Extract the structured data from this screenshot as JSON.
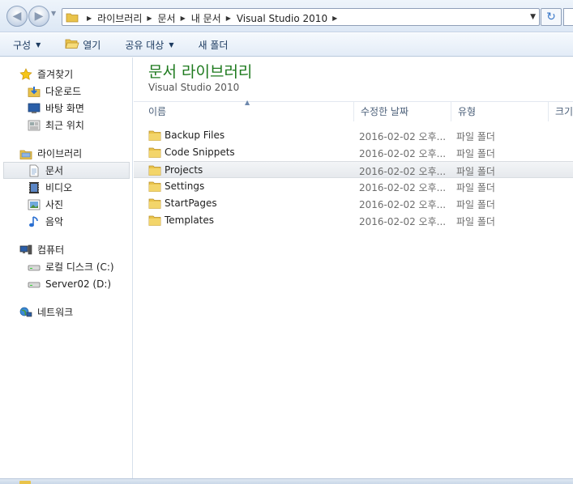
{
  "address": {
    "crumbs": [
      "라이브러리",
      "문서",
      "내 문서",
      "Visual Studio 2010"
    ]
  },
  "toolbar": {
    "organize": "구성",
    "open": "열기",
    "share": "공유 대상",
    "new_folder": "새 폴더"
  },
  "nav": {
    "favorites": {
      "label": "즐겨찾기",
      "items": [
        "다운로드",
        "바탕 화면",
        "최근 위치"
      ]
    },
    "libraries": {
      "label": "라이브러리",
      "items": [
        "문서",
        "비디오",
        "사진",
        "음악"
      ]
    },
    "computer": {
      "label": "컴퓨터",
      "items": [
        "로컬 디스크 (C:)",
        "Server02 (D:)"
      ]
    },
    "network": {
      "label": "네트워크"
    }
  },
  "library": {
    "title": "문서 라이브러리",
    "subtitle": "Visual Studio 2010"
  },
  "columns": {
    "name": "이름",
    "date": "수정한 날짜",
    "type": "유형",
    "size": "크기"
  },
  "files": [
    {
      "name": "Backup Files",
      "date": "2016-02-02 오후...",
      "type": "파일 폴더"
    },
    {
      "name": "Code Snippets",
      "date": "2016-02-02 오후...",
      "type": "파일 폴더"
    },
    {
      "name": "Projects",
      "date": "2016-02-02 오후...",
      "type": "파일 폴더"
    },
    {
      "name": "Settings",
      "date": "2016-02-02 오후...",
      "type": "파일 폴더"
    },
    {
      "name": "StartPages",
      "date": "2016-02-02 오후...",
      "type": "파일 폴더"
    },
    {
      "name": "Templates",
      "date": "2016-02-02 오후...",
      "type": "파일 폴더"
    }
  ],
  "selected_file": "Projects",
  "selected_nav": "문서",
  "colors": {
    "library_title": "#1e7a1e",
    "command_text": "#1c3a60",
    "folder": "#e9c34a"
  }
}
